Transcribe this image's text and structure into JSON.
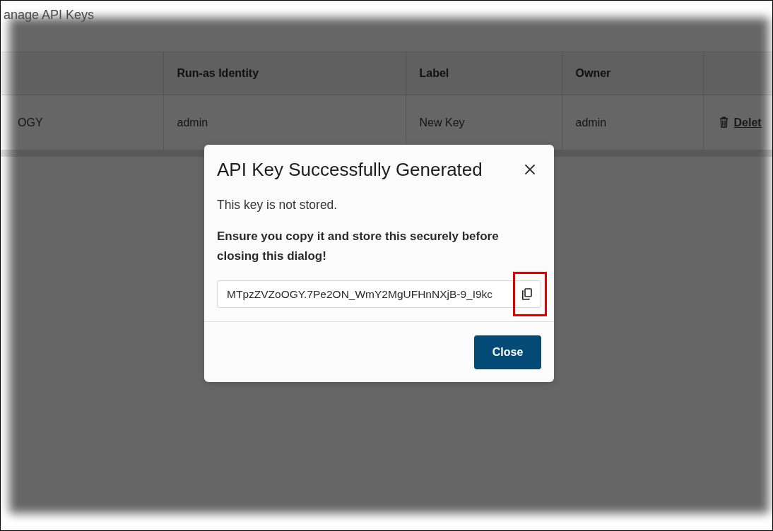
{
  "page": {
    "title": "anage API Keys"
  },
  "table": {
    "headings": {
      "run_as_identity": "Run-as Identity",
      "label": "Label",
      "owner": "Owner"
    },
    "rows": [
      {
        "column_1": "OGY",
        "run_as_identity": "admin",
        "label": "New Key",
        "owner": "admin",
        "delete_link": "Delet"
      }
    ]
  },
  "dialog": {
    "title": "API Key Successfully Generated",
    "messages": [
      {
        "kind": "plain",
        "text": "This key is not stored."
      },
      {
        "kind": "bold",
        "text": "Ensure you copy it and store this securely before closing this dialog!"
      }
    ],
    "key_field": {
      "value": "MTpzZVZoOGY.7Pe2ON_WmY2MgUFHnNXjB-9_I9kc"
    },
    "copy_button": {
      "highlighted": true
    },
    "buttons": [
      {
        "kind": "primary",
        "label": "Close"
      }
    ]
  }
}
